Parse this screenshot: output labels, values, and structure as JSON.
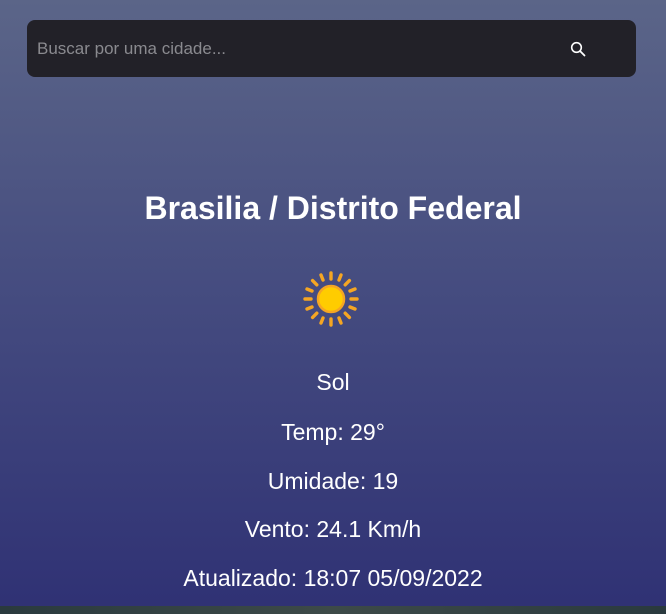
{
  "search": {
    "placeholder": "Buscar por uma cidade...",
    "value": "",
    "button_icon": "search-icon"
  },
  "weather": {
    "location": "Brasilia / Distrito Federal",
    "icon": "sun-icon",
    "condition": "Sol",
    "temperature": "Temp: 29°",
    "humidity": "Umidade: 19",
    "wind": "Vento: 24.1 Km/h",
    "updated": "Atualizado: 18:07 05/09/2022"
  },
  "colors": {
    "background_top": "#5b6588",
    "background_bottom": "#2f3174",
    "search_background": "#222128",
    "text": "#ffffff",
    "sun": "#ffcc00",
    "sun_rays": "#f5a623"
  }
}
